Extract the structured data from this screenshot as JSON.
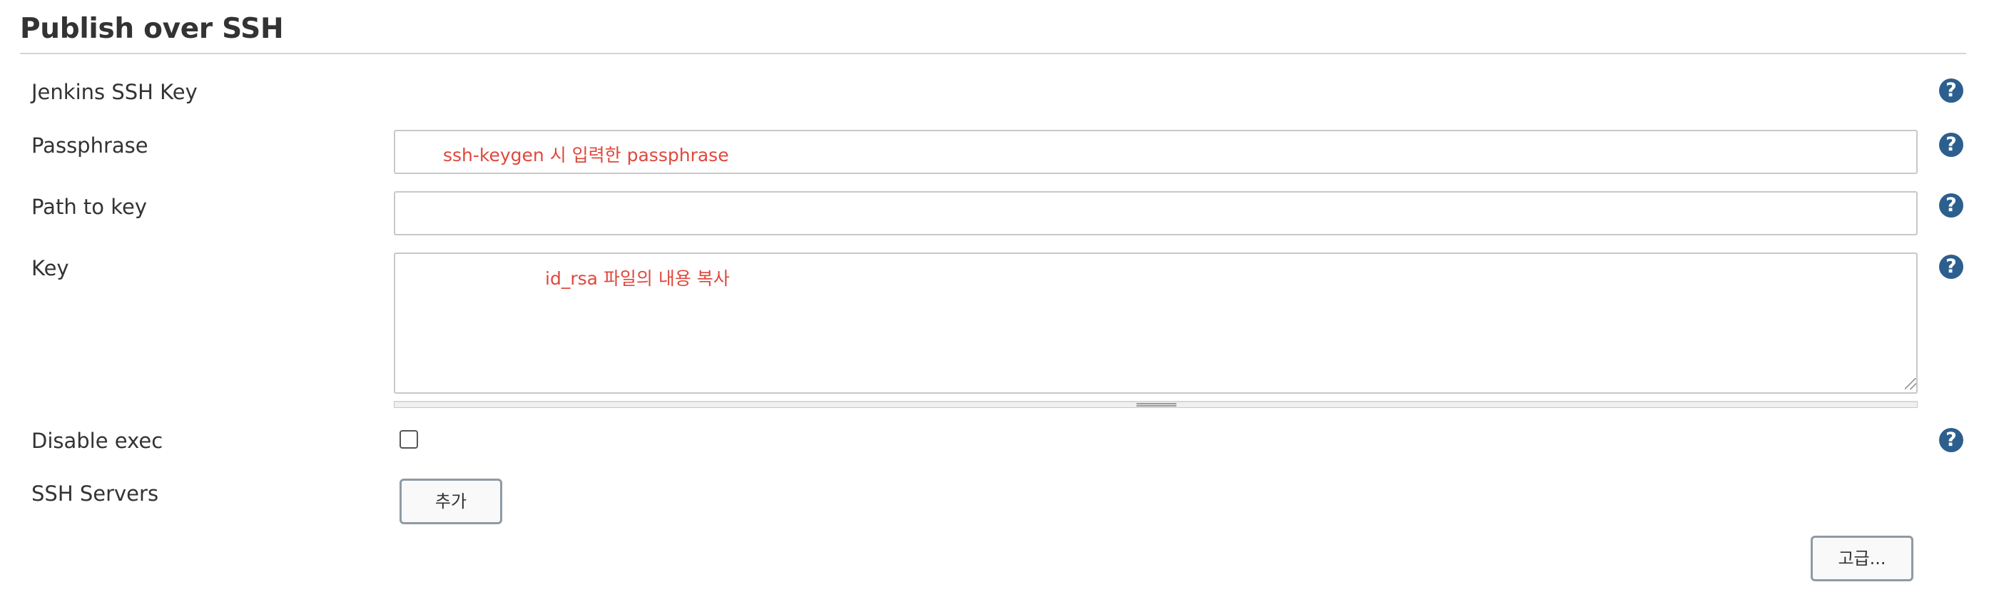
{
  "section": {
    "title": "Publish over SSH"
  },
  "fields": {
    "jenkins_ssh_key": {
      "label": "Jenkins SSH Key"
    },
    "passphrase": {
      "label": "Passphrase",
      "value": "",
      "annotation": "ssh-keygen 시 입력한 passphrase"
    },
    "path_to_key": {
      "label": "Path to key",
      "value": ""
    },
    "key": {
      "label": "Key",
      "value": "",
      "annotation": "id_rsa 파일의 내용 복사"
    },
    "disable_exec": {
      "label": "Disable exec",
      "checked": false
    },
    "ssh_servers": {
      "label": "SSH Servers",
      "add_button": "추가"
    }
  },
  "advanced_button": "고급...",
  "help_icon_glyph": "?",
  "icons": {
    "help": "help-circle-icon",
    "resize": "resize-grip-icon"
  },
  "colors": {
    "help_icon": "#2c5f8e",
    "annotation": "#e0483d"
  }
}
